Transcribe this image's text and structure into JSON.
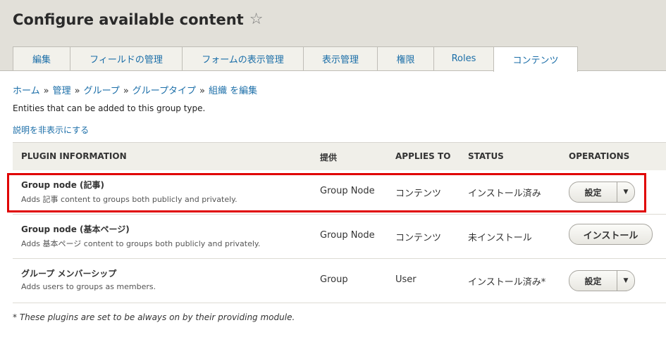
{
  "page": {
    "title": "Configure available content"
  },
  "tabs": [
    {
      "label": "編集"
    },
    {
      "label": "フィールドの管理"
    },
    {
      "label": "フォームの表示管理"
    },
    {
      "label": "表示管理"
    },
    {
      "label": "権限"
    },
    {
      "label": "Roles"
    },
    {
      "label": "コンテンツ"
    }
  ],
  "breadcrumb": [
    {
      "label": "ホーム"
    },
    {
      "label": "管理"
    },
    {
      "label": "グループ"
    },
    {
      "label": "グループタイプ"
    },
    {
      "label": "組織 を編集"
    }
  ],
  "breadcrumb_sep": "»",
  "description": "Entities that can be added to this group type.",
  "hide_description_link": "説明を非表示にする",
  "table": {
    "headers": {
      "plugin_info": "PLUGIN INFORMATION",
      "provider": "提供",
      "applies_to": "APPLIES TO",
      "status": "STATUS",
      "operations": "OPERATIONS"
    },
    "rows": [
      {
        "name": "Group node (記事)",
        "description": "Adds 記事 content to groups both publicly and privately.",
        "provider": "Group Node",
        "applies_to": "コンテンツ",
        "status": "インストール済み",
        "operation": "設定",
        "has_dropdown": true
      },
      {
        "name": "Group node (基本ページ)",
        "description": "Adds 基本ページ content to groups both publicly and privately.",
        "provider": "Group Node",
        "applies_to": "コンテンツ",
        "status": "未インストール",
        "operation": "インストール",
        "has_dropdown": false
      },
      {
        "name": "グループ メンバーシップ",
        "description": "Adds users to groups as members.",
        "provider": "Group",
        "applies_to": "User",
        "status": "インストール済み*",
        "operation": "設定",
        "has_dropdown": true
      }
    ]
  },
  "footnote": "* These plugins are set to be always on by their providing module.",
  "icons": {
    "favorite": "star-outline-icon",
    "dropdown": "caret-down-icon",
    "star_glyph": "☆",
    "caret_glyph": "▼"
  },
  "colors": {
    "link": "#1b6ea8",
    "header_bg": "#e2e0d9",
    "highlight": "#e00000"
  }
}
